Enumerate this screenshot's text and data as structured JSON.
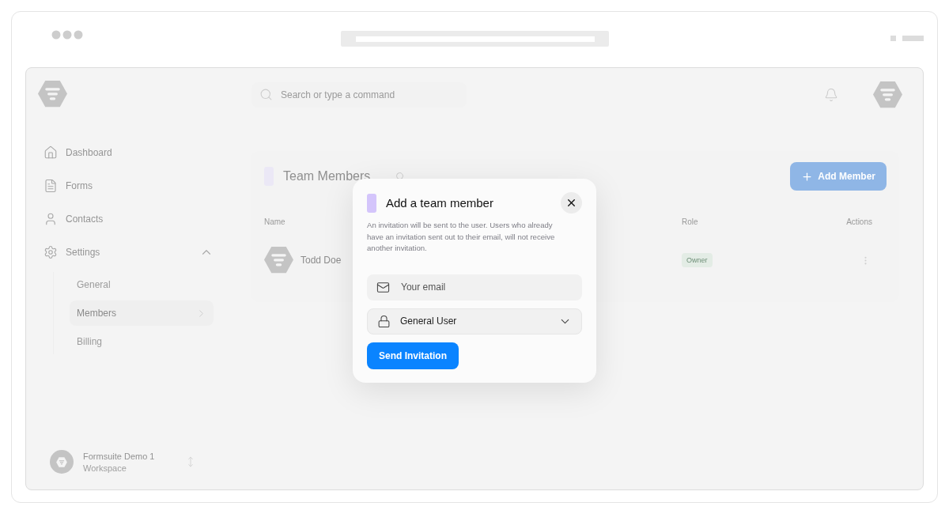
{
  "sidebar": {
    "items": [
      {
        "label": "Dashboard",
        "kind": "home"
      },
      {
        "label": "Forms",
        "kind": "document"
      },
      {
        "label": "Contacts",
        "kind": "person"
      },
      {
        "label": "Settings",
        "kind": "gear",
        "expanded": true,
        "children": [
          {
            "label": "General",
            "selected": false
          },
          {
            "label": "Members",
            "selected": true
          },
          {
            "label": "Billing",
            "selected": false
          }
        ]
      }
    ],
    "workspace": {
      "name": "Formsuite Demo 1",
      "subtitle": "Workspace"
    }
  },
  "topbar": {
    "search": {
      "placeholder": "Search or type a command"
    }
  },
  "members": {
    "title": "Team Members",
    "add_button": "Add Member",
    "columns": [
      "Name",
      "Role",
      "Actions"
    ],
    "rows": [
      {
        "name": "Todd Doe",
        "role": "Owner"
      }
    ]
  },
  "dialog": {
    "title": "Add a team member",
    "description": "An invitation will be sent to the user. Users who already have an invitation sent out to their email, will not receive another invitation.",
    "email": {
      "placeholder": "Your email"
    },
    "role_select": {
      "value": "General User"
    },
    "submit": "Send Invitation"
  }
}
